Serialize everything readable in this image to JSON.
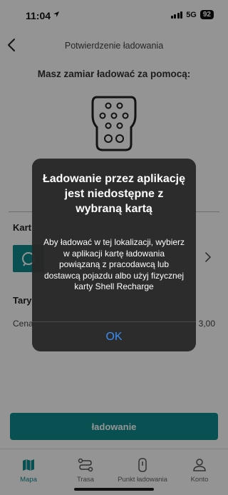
{
  "status_bar": {
    "time": "11:04",
    "network": "5G",
    "battery": "92"
  },
  "header": {
    "title": "Potwierdzenie ładowania"
  },
  "main": {
    "prompt": "Masz zamiar ładować za pomocą:",
    "card_label": "Kart",
    "tariff_label": "Tary",
    "price_label": "Cena",
    "price_value": "3,00",
    "cta_label": "ładowanie"
  },
  "tabbar": {
    "items": [
      {
        "label": "Mapa",
        "icon": "map-icon"
      },
      {
        "label": "Trasa",
        "icon": "route-icon"
      },
      {
        "label": "Punkt ładowania",
        "icon": "charge-point-icon"
      },
      {
        "label": "Konto",
        "icon": "user-icon"
      }
    ]
  },
  "alert": {
    "title": "Ładowanie przez aplikację jest niedostępne z wybraną kartą",
    "message": "Aby ładować w tej lokalizacji, wybierz w aplikacji kartę ładowania powiązaną z pracodawcą lub dostawcą pojazdu albo użyj fizycznej karty Shell Recharge",
    "ok_label": "OK"
  },
  "colors": {
    "accent": "#0f8a8c",
    "alert_link": "#3b8ef3"
  }
}
